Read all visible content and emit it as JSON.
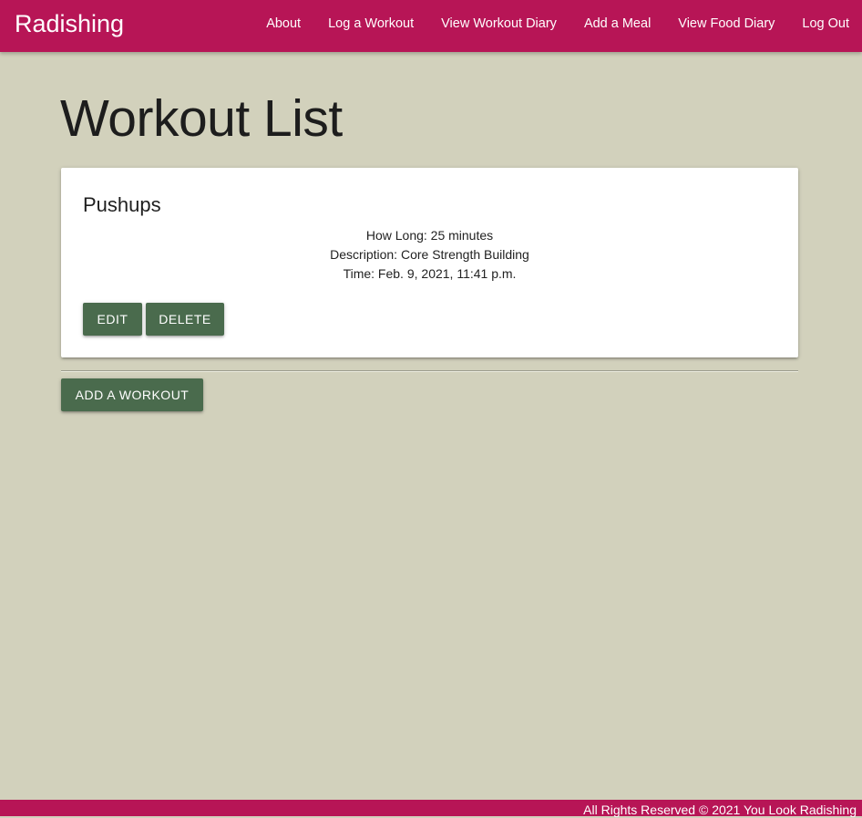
{
  "navbar": {
    "brand": "Radishing",
    "links": [
      {
        "label": "About"
      },
      {
        "label": "Log a Workout"
      },
      {
        "label": "View Workout Diary"
      },
      {
        "label": "Add a Meal"
      },
      {
        "label": "View Food Diary"
      },
      {
        "label": "Log Out"
      }
    ]
  },
  "main": {
    "title": "Workout List",
    "workouts": [
      {
        "name": "Pushups",
        "how_long": "How Long: 25 minutes",
        "description": "Description: Core Strength Building",
        "time": "Time: Feb. 9, 2021, 11:41 p.m.",
        "edit_label": "EDIT",
        "delete_label": "DELETE"
      }
    ],
    "add_button_label": "ADD A WORKOUT"
  },
  "footer": {
    "text": "All Rights Reserved © 2021 You Look Radishing"
  },
  "colors": {
    "brand": "#b71556",
    "background": "#d2d1bc",
    "button": "#4a6b4d"
  }
}
